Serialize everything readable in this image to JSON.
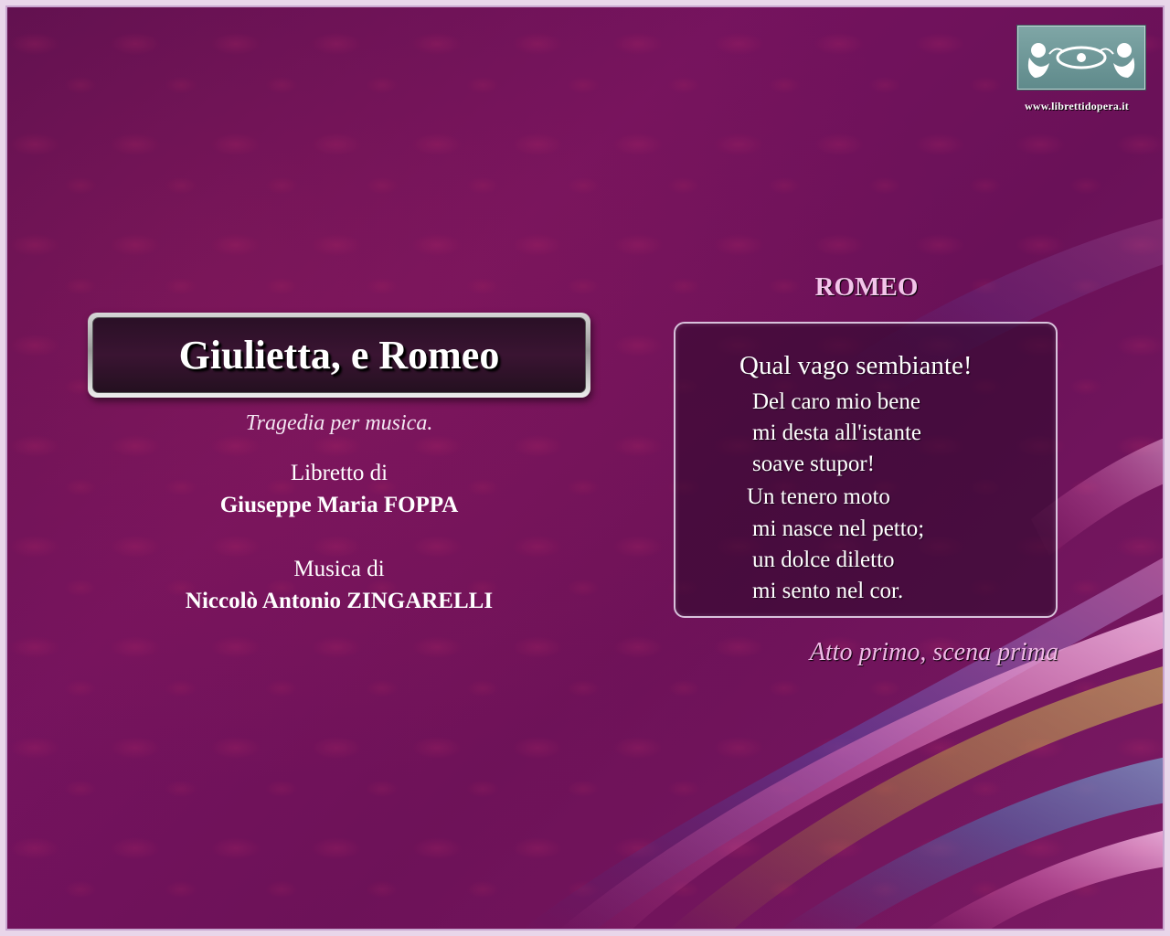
{
  "site": {
    "url": "www.librettidopera.it",
    "logo_icon": "putti-garland-emblem"
  },
  "work": {
    "title": "Giulietta, e Romeo",
    "subtitle": "Tragedia per musica.",
    "libretto_label": "Libretto di",
    "librettist": "Giuseppe Maria FOPPA",
    "music_label": "Musica di",
    "composer": "Niccolò Antonio ZINGARELLI"
  },
  "excerpt": {
    "character": "ROMEO",
    "lines": [
      "Qual vago sembiante!",
      "Del caro mio bene",
      "mi desta all'istante",
      "soave stupor!",
      "Un tenero moto",
      "mi nasce nel petto;",
      "un dolce diletto",
      "mi sento nel cor."
    ],
    "scene": "Atto primo, scena prima"
  },
  "colors": {
    "background": "#6a1158",
    "accent_pink": "#f3c4ea",
    "logo_bg": "#6f9898"
  }
}
